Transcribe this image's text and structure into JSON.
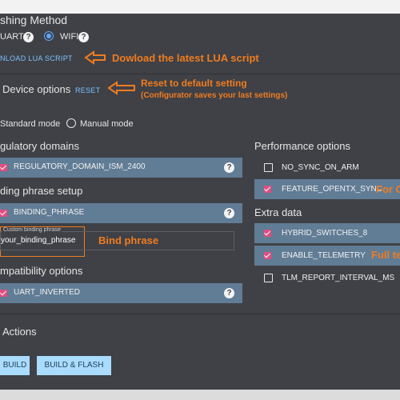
{
  "flashing": {
    "title": "shing Method",
    "uart_label": "UART",
    "wifi_label": "WIFI",
    "selected": "WIFI",
    "download_link": "NLOAD LUA SCRIPT",
    "help_glyph": "?"
  },
  "device_options": {
    "title": "Device options",
    "reset_label": "RESET",
    "mode_standard": "Standard mode",
    "mode_manual": "Manual mode",
    "selected_mode": "Manual mode"
  },
  "regulatory": {
    "title": "gulatory domains",
    "item": "REGULATORY_DOMAIN_ISM_2400",
    "checked": true
  },
  "binding": {
    "title": "ding phrase setup",
    "item": "BINDING_PHRASE",
    "checked": true,
    "field_label": "Custom binding phrase",
    "field_value": "your_binding_phrase"
  },
  "compat": {
    "title": "mpatibility options",
    "item": "UART_INVERTED",
    "checked": true
  },
  "performance": {
    "title": "Performance options",
    "items": [
      {
        "label": "NO_SYNC_ON_ARM",
        "checked": false
      },
      {
        "label": "FEATURE_OPENTX_SYNC",
        "checked": true
      }
    ]
  },
  "extra": {
    "title": "Extra data",
    "items": [
      {
        "label": "HYBRID_SWITCHES_8",
        "checked": true
      },
      {
        "label": "ENABLE_TELEMETRY",
        "checked": true
      },
      {
        "label": "TLM_REPORT_INTERVAL_MS",
        "checked": false
      }
    ]
  },
  "actions": {
    "title": "Actions",
    "build_label": "BUILD",
    "build_flash_label": "BUILD & FLASH"
  },
  "annotations": {
    "download": "Dowload the latest LUA script",
    "reset_line1": "Reset to default setting",
    "reset_line2": "(Configurator saves your last settings)",
    "bind": "Bind phrase",
    "opentx": "For O",
    "telemetry": "Full te"
  },
  "colors": {
    "panel_bg": "#3f4146",
    "row_bg": "#617c95",
    "checkbox_on": "#e44d7e",
    "accent_blue": "#5aa9ff",
    "annotation_orange": "#f07c20",
    "button_bg": "#a9dcff"
  }
}
